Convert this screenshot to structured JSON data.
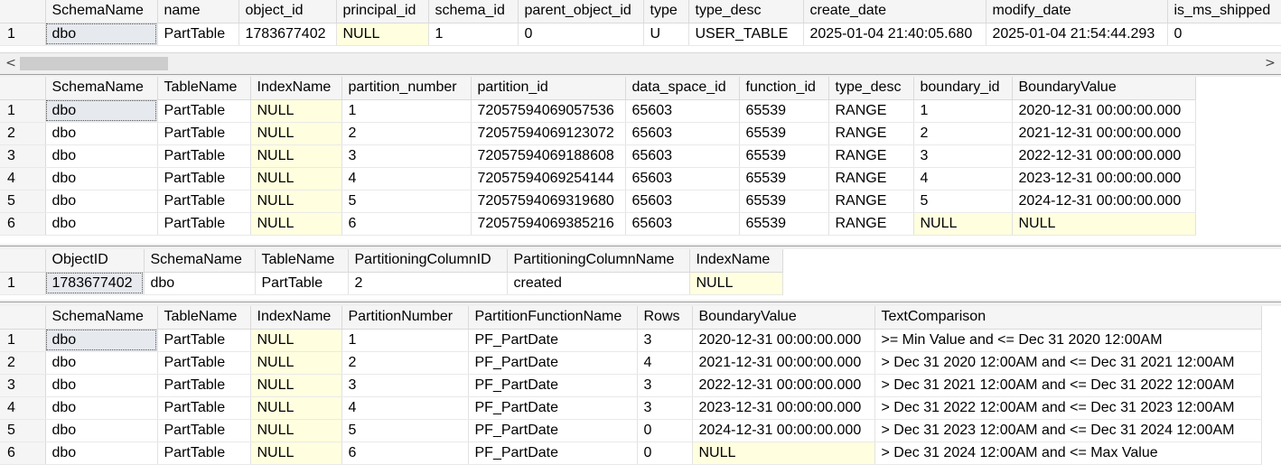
{
  "grid1": {
    "columns": [
      "",
      "SchemaName",
      "name",
      "object_id",
      "principal_id",
      "schema_id",
      "parent_object_id",
      "type",
      "type_desc",
      "create_date",
      "modify_date",
      "is_ms_shipped"
    ],
    "rows": [
      [
        "1",
        "dbo",
        "PartTable",
        "1783677402",
        "NULL",
        "1",
        "0",
        "U",
        "USER_TABLE",
        "2025-01-04 21:40:05.680",
        "2025-01-04 21:54:44.293",
        "0"
      ]
    ]
  },
  "scrollbar": {
    "left_arrow": "<",
    "right_arrow": ">"
  },
  "grid2": {
    "columns": [
      "",
      "SchemaName",
      "TableName",
      "IndexName",
      "partition_number",
      "partition_id",
      "data_space_id",
      "function_id",
      "type_desc",
      "boundary_id",
      "BoundaryValue"
    ],
    "rows": [
      [
        "1",
        "dbo",
        "PartTable",
        "NULL",
        "1",
        "72057594069057536",
        "65603",
        "65539",
        "RANGE",
        "1",
        "2020-12-31 00:00:00.000"
      ],
      [
        "2",
        "dbo",
        "PartTable",
        "NULL",
        "2",
        "72057594069123072",
        "65603",
        "65539",
        "RANGE",
        "2",
        "2021-12-31 00:00:00.000"
      ],
      [
        "3",
        "dbo",
        "PartTable",
        "NULL",
        "3",
        "72057594069188608",
        "65603",
        "65539",
        "RANGE",
        "3",
        "2022-12-31 00:00:00.000"
      ],
      [
        "4",
        "dbo",
        "PartTable",
        "NULL",
        "4",
        "72057594069254144",
        "65603",
        "65539",
        "RANGE",
        "4",
        "2023-12-31 00:00:00.000"
      ],
      [
        "5",
        "dbo",
        "PartTable",
        "NULL",
        "5",
        "72057594069319680",
        "65603",
        "65539",
        "RANGE",
        "5",
        "2024-12-31 00:00:00.000"
      ],
      [
        "6",
        "dbo",
        "PartTable",
        "NULL",
        "6",
        "72057594069385216",
        "65603",
        "65539",
        "RANGE",
        "NULL",
        "NULL"
      ]
    ]
  },
  "grid3": {
    "columns": [
      "",
      "ObjectID",
      "SchemaName",
      "TableName",
      "PartitioningColumnID",
      "PartitioningColumnName",
      "IndexName"
    ],
    "rows": [
      [
        "1",
        "1783677402",
        "dbo",
        "PartTable",
        "2",
        "created",
        "NULL"
      ]
    ]
  },
  "grid4": {
    "columns": [
      "",
      "SchemaName",
      "TableName",
      "IndexName",
      "PartitionNumber",
      "PartitionFunctionName",
      "Rows",
      "BoundaryValue",
      "TextComparison"
    ],
    "rows": [
      [
        "1",
        "dbo",
        "PartTable",
        "NULL",
        "1",
        "PF_PartDate",
        "3",
        "2020-12-31 00:00:00.000",
        ">= Min Value and <= Dec 31 2020 12:00AM"
      ],
      [
        "2",
        "dbo",
        "PartTable",
        "NULL",
        "2",
        "PF_PartDate",
        "4",
        "2021-12-31 00:00:00.000",
        "> Dec 31 2020 12:00AM and <= Dec 31 2021 12:00AM"
      ],
      [
        "3",
        "dbo",
        "PartTable",
        "NULL",
        "3",
        "PF_PartDate",
        "3",
        "2022-12-31 00:00:00.000",
        "> Dec 31 2021 12:00AM and <= Dec 31 2022 12:00AM"
      ],
      [
        "4",
        "dbo",
        "PartTable",
        "NULL",
        "4",
        "PF_PartDate",
        "3",
        "2023-12-31 00:00:00.000",
        "> Dec 31 2022 12:00AM and <= Dec 31 2023 12:00AM"
      ],
      [
        "5",
        "dbo",
        "PartTable",
        "NULL",
        "5",
        "PF_PartDate",
        "0",
        "2024-12-31 00:00:00.000",
        "> Dec 31 2023 12:00AM and <= Dec 31 2024 12:00AM"
      ],
      [
        "6",
        "dbo",
        "PartTable",
        "NULL",
        "6",
        "PF_PartDate",
        "0",
        "NULL",
        "> Dec 31 2024 12:00AM and <= Max Value"
      ]
    ]
  }
}
